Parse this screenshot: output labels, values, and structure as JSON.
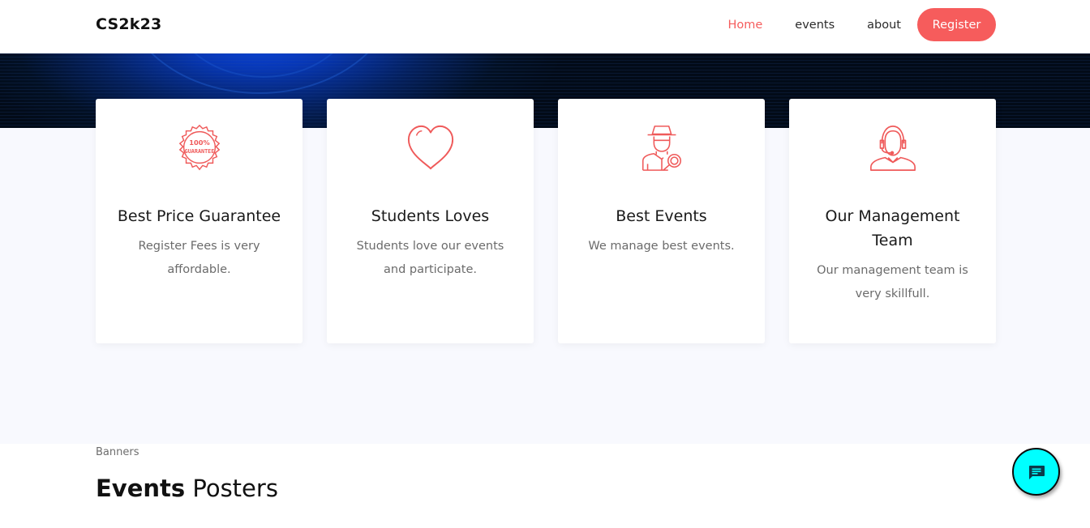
{
  "brand": {
    "logo_text": "CS2k23"
  },
  "nav": {
    "items": [
      {
        "label": "Home",
        "active": true
      },
      {
        "label": "events",
        "active": false
      },
      {
        "label": "about",
        "active": false
      }
    ],
    "register_label": "Register"
  },
  "features": [
    {
      "icon": "guarantee-badge-icon",
      "title": "Best Price Guarantee",
      "text": "Register Fees is very affordable."
    },
    {
      "icon": "heart-icon",
      "title": "Students Loves",
      "text": "Students love our events and participate."
    },
    {
      "icon": "detective-search-icon",
      "title": "Best Events",
      "text": "We manage best events."
    },
    {
      "icon": "support-agent-icon",
      "title": "Our Management Team",
      "text": "Our management team is very skillfull."
    }
  ],
  "badge_text": {
    "line1": "100%",
    "line2": "GUARANTEE"
  },
  "section": {
    "eyebrow": "Banners",
    "title_bold": "Events",
    "title_light": "Posters"
  },
  "chat": {
    "icon": "chat-message-icon"
  },
  "colors": {
    "accent": "#f65c5c",
    "nav_active": "#f55d5d",
    "chat_fab": "#00ffff",
    "features_bg": "#f8f9fe",
    "hero_bg": "#020d1c"
  }
}
